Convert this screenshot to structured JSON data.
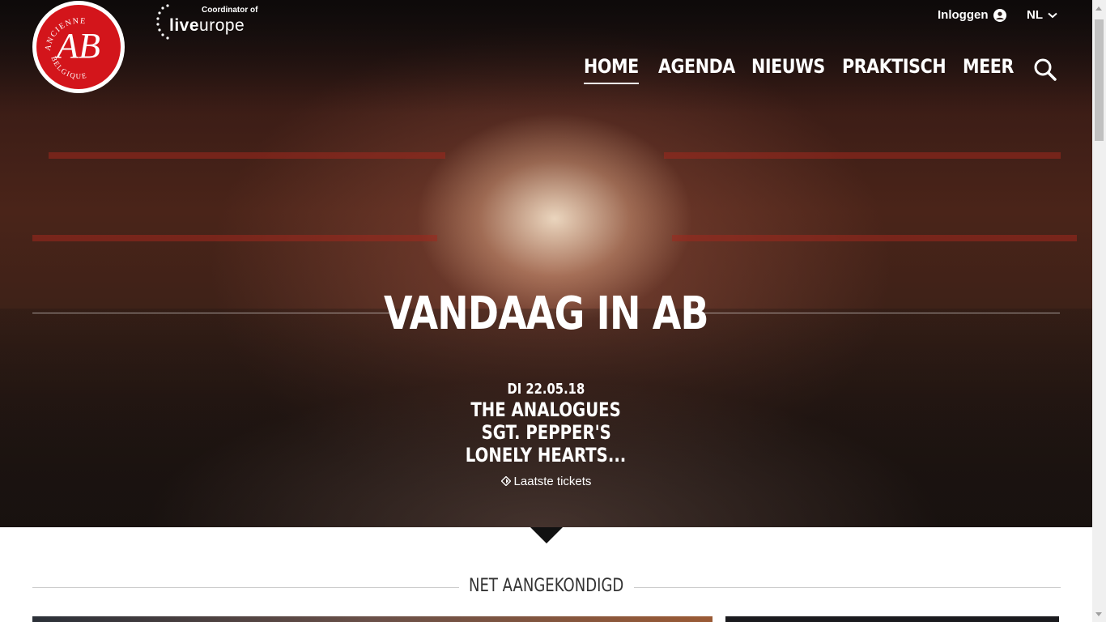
{
  "header": {
    "logo_line_top": "ANCIENNE",
    "logo_letters": "AB",
    "logo_line_bottom": "BELGIQUE",
    "partner_caption": "Coordinator of",
    "partner_word_bold": "live",
    "partner_word_light": "urope",
    "login_label": "Inloggen",
    "language": "NL"
  },
  "nav": {
    "items": [
      {
        "label": "HOME",
        "active": true
      },
      {
        "label": "AGENDA"
      },
      {
        "label": "NIEUWS"
      },
      {
        "label": "PRAKTISCH"
      },
      {
        "label": "MEER"
      }
    ]
  },
  "hero": {
    "title": "VANDAAG IN AB",
    "date": "DI 22.05.18",
    "event_lines": [
      "THE ANALOGUES",
      "SGT. PEPPER'S",
      "LONELY HEARTS..."
    ],
    "ticket_status": "Laatste tickets"
  },
  "section": {
    "title": "NET AANGEKONDIGD"
  },
  "colors": {
    "brand_red": "#d3151b",
    "text_light": "#ffffff"
  }
}
